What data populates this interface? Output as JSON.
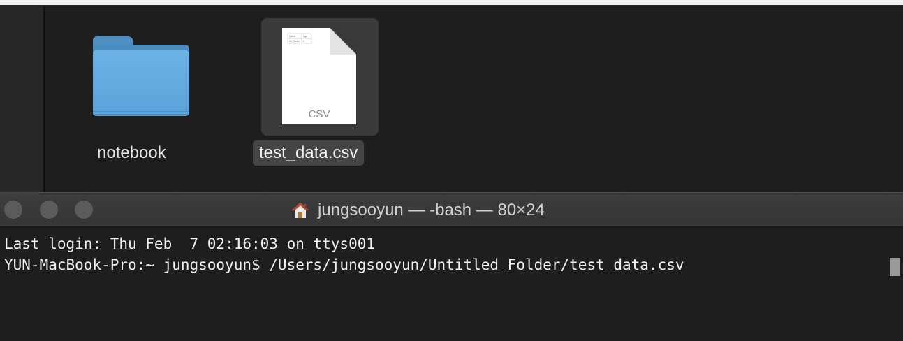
{
  "finder": {
    "items": [
      {
        "name": "notebook",
        "icon": "folder-icon"
      },
      {
        "name": "test_data.csv",
        "icon": "csv-document-icon",
        "selected": true,
        "badge": "CSV",
        "preview_cells": [
          "Name",
          "Age",
          "Kil_Dinter",
          "6"
        ]
      }
    ]
  },
  "terminal": {
    "title": "jungsooyun — -bash — 80×24",
    "title_icon": "home-icon",
    "lines": [
      "Last login: Thu Feb  7 02:16:03 on ttys001",
      "YUN-MacBook-Pro:~ jungsooyun$ /Users/jungsooyun/Untitled_Folder/test_data.csv "
    ]
  },
  "colors": {
    "folder_blue": "#5aa3da",
    "selection_bg": "#3a3a3a",
    "terminal_bg": "#1e1e1e"
  }
}
